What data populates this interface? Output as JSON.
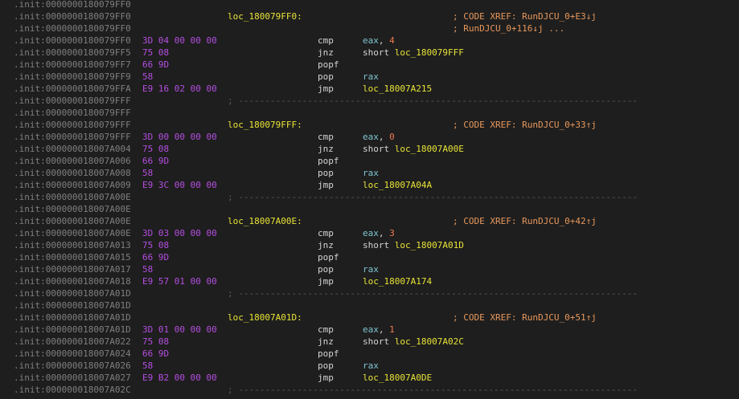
{
  "listing": {
    "separator": "; ---------------------------------------------------------------------------",
    "rows": [
      {
        "addr": ".init:0000000180079FF0"
      },
      {
        "addr": ".init:0000000180079FF0",
        "label": "loc_180079FF0:",
        "xref": "; CODE XREF: RunDJCU_0+E3↓j"
      },
      {
        "addr": ".init:0000000180079FF0",
        "xref": "; RunDJCU_0+116↓j ..."
      },
      {
        "addr": ".init:0000000180079FF0",
        "bytes": "3D 04 00 00 00",
        "mnem": "cmp",
        "ops": [
          {
            "t": "eax",
            "k": "reg"
          },
          {
            "t": ", ",
            "k": "plain"
          },
          {
            "t": "4",
            "k": "num"
          }
        ]
      },
      {
        "addr": ".init:0000000180079FF5",
        "bytes": "75 08",
        "mnem": "jnz",
        "ops": [
          {
            "t": "short ",
            "k": "kw"
          },
          {
            "t": "loc_180079FFF",
            "k": "tgt"
          }
        ]
      },
      {
        "addr": ".init:0000000180079FF7",
        "bytes": "66 9D",
        "mnem": "popf"
      },
      {
        "addr": ".init:0000000180079FF9",
        "bytes": "58",
        "mnem": "pop",
        "ops": [
          {
            "t": "rax",
            "k": "reg"
          }
        ]
      },
      {
        "addr": ".init:0000000180079FFA",
        "bytes": "E9 16 02 00 00",
        "mnem": "jmp",
        "ops": [
          {
            "t": "loc_18007A215",
            "k": "tgt"
          }
        ]
      },
      {
        "addr": ".init:0000000180079FFF",
        "sep": true
      },
      {
        "addr": ".init:0000000180079FFF"
      },
      {
        "addr": ".init:0000000180079FFF",
        "label": "loc_180079FFF:",
        "xref": "; CODE XREF: RunDJCU_0+33↑j"
      },
      {
        "addr": ".init:0000000180079FFF",
        "bytes": "3D 00 00 00 00",
        "mnem": "cmp",
        "ops": [
          {
            "t": "eax",
            "k": "reg"
          },
          {
            "t": ", ",
            "k": "plain"
          },
          {
            "t": "0",
            "k": "num"
          }
        ]
      },
      {
        "addr": ".init:000000018007A004",
        "bytes": "75 08",
        "mnem": "jnz",
        "ops": [
          {
            "t": "short ",
            "k": "kw"
          },
          {
            "t": "loc_18007A00E",
            "k": "tgt"
          }
        ]
      },
      {
        "addr": ".init:000000018007A006",
        "bytes": "66 9D",
        "mnem": "popf"
      },
      {
        "addr": ".init:000000018007A008",
        "bytes": "58",
        "mnem": "pop",
        "ops": [
          {
            "t": "rax",
            "k": "reg"
          }
        ]
      },
      {
        "addr": ".init:000000018007A009",
        "bytes": "E9 3C 00 00 00",
        "mnem": "jmp",
        "ops": [
          {
            "t": "loc_18007A04A",
            "k": "tgt"
          }
        ]
      },
      {
        "addr": ".init:000000018007A00E",
        "sep": true
      },
      {
        "addr": ".init:000000018007A00E"
      },
      {
        "addr": ".init:000000018007A00E",
        "label": "loc_18007A00E:",
        "xref": "; CODE XREF: RunDJCU_0+42↑j"
      },
      {
        "addr": ".init:000000018007A00E",
        "bytes": "3D 03 00 00 00",
        "mnem": "cmp",
        "ops": [
          {
            "t": "eax",
            "k": "reg"
          },
          {
            "t": ", ",
            "k": "plain"
          },
          {
            "t": "3",
            "k": "num"
          }
        ]
      },
      {
        "addr": ".init:000000018007A013",
        "bytes": "75 08",
        "mnem": "jnz",
        "ops": [
          {
            "t": "short ",
            "k": "kw"
          },
          {
            "t": "loc_18007A01D",
            "k": "tgt"
          }
        ]
      },
      {
        "addr": ".init:000000018007A015",
        "bytes": "66 9D",
        "mnem": "popf"
      },
      {
        "addr": ".init:000000018007A017",
        "bytes": "58",
        "mnem": "pop",
        "ops": [
          {
            "t": "rax",
            "k": "reg"
          }
        ]
      },
      {
        "addr": ".init:000000018007A018",
        "bytes": "E9 57 01 00 00",
        "mnem": "jmp",
        "ops": [
          {
            "t": "loc_18007A174",
            "k": "tgt"
          }
        ]
      },
      {
        "addr": ".init:000000018007A01D",
        "sep": true
      },
      {
        "addr": ".init:000000018007A01D"
      },
      {
        "addr": ".init:000000018007A01D",
        "label": "loc_18007A01D:",
        "xref": "; CODE XREF: RunDJCU_0+51↑j"
      },
      {
        "addr": ".init:000000018007A01D",
        "bytes": "3D 01 00 00 00",
        "mnem": "cmp",
        "ops": [
          {
            "t": "eax",
            "k": "reg"
          },
          {
            "t": ", ",
            "k": "plain"
          },
          {
            "t": "1",
            "k": "num"
          }
        ]
      },
      {
        "addr": ".init:000000018007A022",
        "bytes": "75 08",
        "mnem": "jnz",
        "ops": [
          {
            "t": "short ",
            "k": "kw"
          },
          {
            "t": "loc_18007A02C",
            "k": "tgt"
          }
        ]
      },
      {
        "addr": ".init:000000018007A024",
        "bytes": "66 9D",
        "mnem": "popf"
      },
      {
        "addr": ".init:000000018007A026",
        "bytes": "58",
        "mnem": "pop",
        "ops": [
          {
            "t": "rax",
            "k": "reg"
          }
        ]
      },
      {
        "addr": ".init:000000018007A027",
        "bytes": "E9 B2 00 00 00",
        "mnem": "jmp",
        "ops": [
          {
            "t": "loc_18007A0DE",
            "k": "tgt"
          }
        ]
      },
      {
        "addr": ".init:000000018007A02C",
        "sep": true
      }
    ]
  }
}
